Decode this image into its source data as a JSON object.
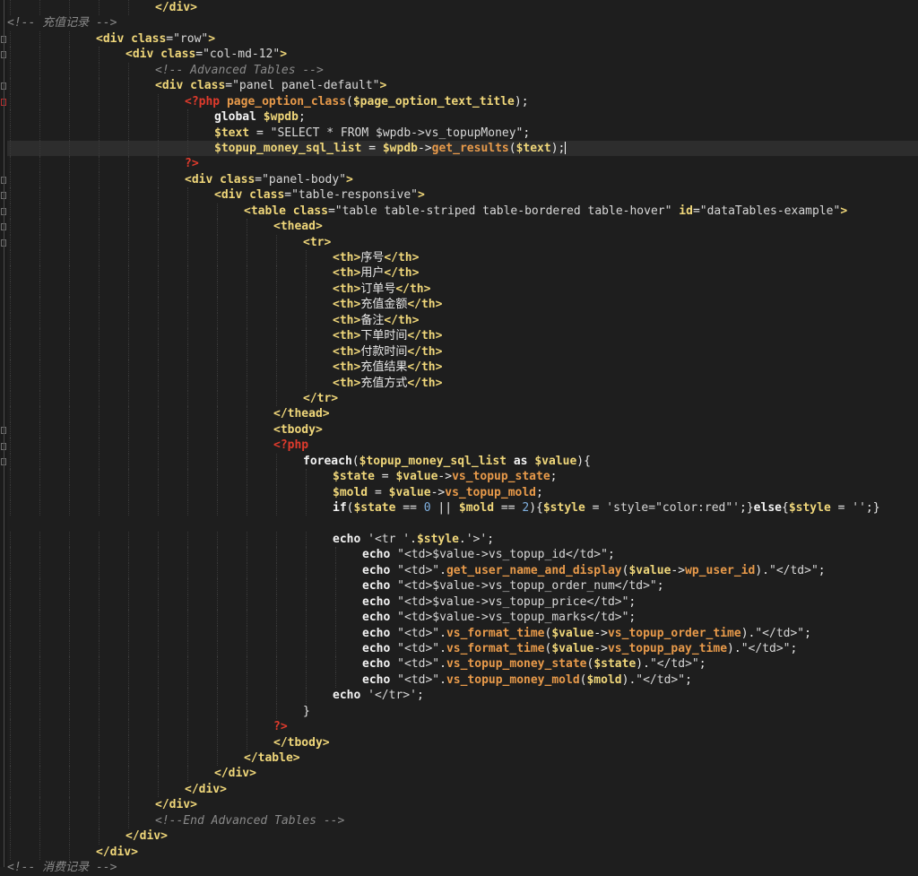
{
  "editor": {
    "title": "code-editor",
    "lines": [
      {
        "indent": 5,
        "tokens": [
          [
            "tag",
            "</div>"
          ]
        ]
      },
      {
        "indent": 0,
        "tokens": [
          [
            "comment",
            "<!-- 充值记录 -->"
          ]
        ]
      },
      {
        "indent": 3,
        "tokens": [
          [
            "tag",
            "<div "
          ],
          [
            "attr",
            "class"
          ],
          [
            "plain",
            "="
          ],
          [
            "str",
            "\"row\""
          ],
          [
            "tag",
            ">"
          ]
        ]
      },
      {
        "indent": 4,
        "tokens": [
          [
            "tag",
            "<div "
          ],
          [
            "attr",
            "class"
          ],
          [
            "plain",
            "="
          ],
          [
            "str",
            "\"col-md-12\""
          ],
          [
            "tag",
            ">"
          ]
        ]
      },
      {
        "indent": 5,
        "tokens": [
          [
            "comment",
            "<!-- Advanced Tables -->"
          ]
        ]
      },
      {
        "indent": 5,
        "tokens": [
          [
            "tag",
            "<div "
          ],
          [
            "attr",
            "class"
          ],
          [
            "plain",
            "="
          ],
          [
            "str",
            "\"panel panel-default\""
          ],
          [
            "tag",
            ">"
          ]
        ]
      },
      {
        "indent": 6,
        "tokens": [
          [
            "php",
            "<?php "
          ],
          [
            "fn",
            "page_option_class"
          ],
          [
            "punct",
            "("
          ],
          [
            "var",
            "$page_option_text_title"
          ],
          [
            "punct",
            ");"
          ]
        ]
      },
      {
        "indent": 7,
        "tokens": [
          [
            "kw",
            "global "
          ],
          [
            "var",
            "$wpdb"
          ],
          [
            "punct",
            ";"
          ]
        ]
      },
      {
        "indent": 7,
        "tokens": [
          [
            "var",
            "$text"
          ],
          [
            "plain",
            " = "
          ],
          [
            "str",
            "\"SELECT * FROM $wpdb->vs_topupMoney\""
          ],
          [
            "punct",
            ";"
          ]
        ]
      },
      {
        "indent": 7,
        "current": true,
        "tokens": [
          [
            "var",
            "$topup_money_sql_list"
          ],
          [
            "plain",
            " = "
          ],
          [
            "var",
            "$wpdb"
          ],
          [
            "plain",
            "->"
          ],
          [
            "fn",
            "get_results"
          ],
          [
            "punct",
            "("
          ],
          [
            "var",
            "$text"
          ],
          [
            "punct",
            ");"
          ],
          [
            "cursor",
            ""
          ]
        ]
      },
      {
        "indent": 6,
        "tokens": [
          [
            "php",
            "?>"
          ]
        ]
      },
      {
        "indent": 6,
        "tokens": [
          [
            "tag",
            "<div "
          ],
          [
            "attr",
            "class"
          ],
          [
            "plain",
            "="
          ],
          [
            "str",
            "\"panel-body\""
          ],
          [
            "tag",
            ">"
          ]
        ]
      },
      {
        "indent": 7,
        "tokens": [
          [
            "tag",
            "<div "
          ],
          [
            "attr",
            "class"
          ],
          [
            "plain",
            "="
          ],
          [
            "str",
            "\"table-responsive\""
          ],
          [
            "tag",
            ">"
          ]
        ]
      },
      {
        "indent": 8,
        "tokens": [
          [
            "tag",
            "<table "
          ],
          [
            "attr",
            "class"
          ],
          [
            "plain",
            "="
          ],
          [
            "str",
            "\"table table-striped table-bordered table-hover\""
          ],
          [
            "plain",
            " "
          ],
          [
            "attr",
            "id"
          ],
          [
            "plain",
            "="
          ],
          [
            "str",
            "\"dataTables-example\""
          ],
          [
            "tag",
            ">"
          ]
        ]
      },
      {
        "indent": 9,
        "tokens": [
          [
            "tag",
            "<thead>"
          ]
        ]
      },
      {
        "indent": 10,
        "tokens": [
          [
            "tag",
            "<tr>"
          ]
        ]
      },
      {
        "indent": 11,
        "tokens": [
          [
            "tag",
            "<th>"
          ],
          [
            "chinese",
            "序号"
          ],
          [
            "tag",
            "</th>"
          ]
        ]
      },
      {
        "indent": 11,
        "tokens": [
          [
            "tag",
            "<th>"
          ],
          [
            "chinese",
            "用户"
          ],
          [
            "tag",
            "</th>"
          ]
        ]
      },
      {
        "indent": 11,
        "tokens": [
          [
            "tag",
            "<th>"
          ],
          [
            "chinese",
            "订单号"
          ],
          [
            "tag",
            "</th>"
          ]
        ]
      },
      {
        "indent": 11,
        "tokens": [
          [
            "tag",
            "<th>"
          ],
          [
            "chinese",
            "充值金额"
          ],
          [
            "tag",
            "</th>"
          ]
        ]
      },
      {
        "indent": 11,
        "tokens": [
          [
            "tag",
            "<th>"
          ],
          [
            "chinese",
            "备注"
          ],
          [
            "tag",
            "</th>"
          ]
        ]
      },
      {
        "indent": 11,
        "tokens": [
          [
            "tag",
            "<th>"
          ],
          [
            "chinese",
            "下单时间"
          ],
          [
            "tag",
            "</th>"
          ]
        ]
      },
      {
        "indent": 11,
        "tokens": [
          [
            "tag",
            "<th>"
          ],
          [
            "chinese",
            "付款时间"
          ],
          [
            "tag",
            "</th>"
          ]
        ]
      },
      {
        "indent": 11,
        "tokens": [
          [
            "tag",
            "<th>"
          ],
          [
            "chinese",
            "充值结果"
          ],
          [
            "tag",
            "</th>"
          ]
        ]
      },
      {
        "indent": 11,
        "tokens": [
          [
            "tag",
            "<th>"
          ],
          [
            "chinese",
            "充值方式"
          ],
          [
            "tag",
            "</th>"
          ]
        ]
      },
      {
        "indent": 10,
        "tokens": [
          [
            "tag",
            "</tr>"
          ]
        ]
      },
      {
        "indent": 9,
        "tokens": [
          [
            "tag",
            "</thead>"
          ]
        ]
      },
      {
        "indent": 9,
        "tokens": [
          [
            "tag",
            "<tbody>"
          ]
        ]
      },
      {
        "indent": 9,
        "tokens": [
          [
            "php",
            "<?php"
          ]
        ]
      },
      {
        "indent": 10,
        "tokens": [
          [
            "kw",
            "foreach"
          ],
          [
            "punct",
            "("
          ],
          [
            "var",
            "$topup_money_sql_list"
          ],
          [
            "kw",
            " as "
          ],
          [
            "var",
            "$value"
          ],
          [
            "punct",
            "){"
          ]
        ]
      },
      {
        "indent": 11,
        "tokens": [
          [
            "var",
            "$state"
          ],
          [
            "plain",
            " = "
          ],
          [
            "var",
            "$value"
          ],
          [
            "plain",
            "->"
          ],
          [
            "fn",
            "vs_topup_state"
          ],
          [
            "punct",
            ";"
          ]
        ]
      },
      {
        "indent": 11,
        "tokens": [
          [
            "var",
            "$mold"
          ],
          [
            "plain",
            " = "
          ],
          [
            "var",
            "$value"
          ],
          [
            "plain",
            "->"
          ],
          [
            "fn",
            "vs_topup_mold"
          ],
          [
            "punct",
            ";"
          ]
        ]
      },
      {
        "indent": 11,
        "tokens": [
          [
            "kw",
            "if"
          ],
          [
            "punct",
            "("
          ],
          [
            "var",
            "$state"
          ],
          [
            "plain",
            " == "
          ],
          [
            "num",
            "0"
          ],
          [
            "plain",
            " || "
          ],
          [
            "var",
            "$mold"
          ],
          [
            "plain",
            " == "
          ],
          [
            "num",
            "2"
          ],
          [
            "punct",
            "){"
          ],
          [
            "var",
            "$style"
          ],
          [
            "plain",
            " = "
          ],
          [
            "str",
            "'style=\"color:red\"'"
          ],
          [
            "punct",
            ";}"
          ],
          [
            "kw",
            "else"
          ],
          [
            "punct",
            "{"
          ],
          [
            "var",
            "$style"
          ],
          [
            "plain",
            " = "
          ],
          [
            "str",
            "''"
          ],
          [
            "punct",
            ";}"
          ]
        ]
      },
      {
        "indent": 0,
        "tokens": []
      },
      {
        "indent": 11,
        "tokens": [
          [
            "kw",
            "echo "
          ],
          [
            "str",
            "'<tr '"
          ],
          [
            "plain",
            "."
          ],
          [
            "var",
            "$style"
          ],
          [
            "plain",
            "."
          ],
          [
            "str",
            "'>'"
          ],
          [
            "punct",
            ";"
          ]
        ]
      },
      {
        "indent": 12,
        "tokens": [
          [
            "kw",
            "echo "
          ],
          [
            "str",
            "\"<td>$value->vs_topup_id</td>\""
          ],
          [
            "punct",
            ";"
          ]
        ]
      },
      {
        "indent": 12,
        "tokens": [
          [
            "kw",
            "echo "
          ],
          [
            "str",
            "\"<td>\""
          ],
          [
            "plain",
            "."
          ],
          [
            "fn",
            "get_user_name_and_display"
          ],
          [
            "punct",
            "("
          ],
          [
            "var",
            "$value"
          ],
          [
            "plain",
            "->"
          ],
          [
            "fn",
            "wp_user_id"
          ],
          [
            "punct",
            ")"
          ],
          [
            "plain",
            "."
          ],
          [
            "str",
            "\"</td>\""
          ],
          [
            "punct",
            ";"
          ]
        ]
      },
      {
        "indent": 12,
        "tokens": [
          [
            "kw",
            "echo "
          ],
          [
            "str",
            "\"<td>$value->vs_topup_order_num</td>\""
          ],
          [
            "punct",
            ";"
          ]
        ]
      },
      {
        "indent": 12,
        "tokens": [
          [
            "kw",
            "echo "
          ],
          [
            "str",
            "\"<td>$value->vs_topup_price</td>\""
          ],
          [
            "punct",
            ";"
          ]
        ]
      },
      {
        "indent": 12,
        "tokens": [
          [
            "kw",
            "echo "
          ],
          [
            "str",
            "\"<td>$value->vs_topup_marks</td>\""
          ],
          [
            "punct",
            ";"
          ]
        ]
      },
      {
        "indent": 12,
        "tokens": [
          [
            "kw",
            "echo "
          ],
          [
            "str",
            "\"<td>\""
          ],
          [
            "plain",
            "."
          ],
          [
            "fn",
            "vs_format_time"
          ],
          [
            "punct",
            "("
          ],
          [
            "var",
            "$value"
          ],
          [
            "plain",
            "->"
          ],
          [
            "fn",
            "vs_topup_order_time"
          ],
          [
            "punct",
            ")"
          ],
          [
            "plain",
            "."
          ],
          [
            "str",
            "\"</td>\""
          ],
          [
            "punct",
            ";"
          ]
        ]
      },
      {
        "indent": 12,
        "tokens": [
          [
            "kw",
            "echo "
          ],
          [
            "str",
            "\"<td>\""
          ],
          [
            "plain",
            "."
          ],
          [
            "fn",
            "vs_format_time"
          ],
          [
            "punct",
            "("
          ],
          [
            "var",
            "$value"
          ],
          [
            "plain",
            "->"
          ],
          [
            "fn",
            "vs_topup_pay_time"
          ],
          [
            "punct",
            ")"
          ],
          [
            "plain",
            "."
          ],
          [
            "str",
            "\"</td>\""
          ],
          [
            "punct",
            ";"
          ]
        ]
      },
      {
        "indent": 12,
        "tokens": [
          [
            "kw",
            "echo "
          ],
          [
            "str",
            "\"<td>\""
          ],
          [
            "plain",
            "."
          ],
          [
            "fn",
            "vs_topup_money_state"
          ],
          [
            "punct",
            "("
          ],
          [
            "var",
            "$state"
          ],
          [
            "punct",
            ")"
          ],
          [
            "plain",
            "."
          ],
          [
            "str",
            "\"</td>\""
          ],
          [
            "punct",
            ";"
          ]
        ]
      },
      {
        "indent": 12,
        "tokens": [
          [
            "kw",
            "echo "
          ],
          [
            "str",
            "\"<td>\""
          ],
          [
            "plain",
            "."
          ],
          [
            "fn",
            "vs_topup_money_mold"
          ],
          [
            "punct",
            "("
          ],
          [
            "var",
            "$mold"
          ],
          [
            "punct",
            ")"
          ],
          [
            "plain",
            "."
          ],
          [
            "str",
            "\"</td>\""
          ],
          [
            "punct",
            ";"
          ]
        ]
      },
      {
        "indent": 11,
        "tokens": [
          [
            "kw",
            "echo "
          ],
          [
            "str",
            "'</tr>'"
          ],
          [
            "punct",
            ";"
          ]
        ]
      },
      {
        "indent": 10,
        "tokens": [
          [
            "punct",
            "}"
          ]
        ]
      },
      {
        "indent": 9,
        "tokens": [
          [
            "php",
            "?>"
          ]
        ]
      },
      {
        "indent": 9,
        "tokens": [
          [
            "tag",
            "</tbody>"
          ]
        ]
      },
      {
        "indent": 8,
        "tokens": [
          [
            "tag",
            "</table>"
          ]
        ]
      },
      {
        "indent": 7,
        "tokens": [
          [
            "tag",
            "</div>"
          ]
        ]
      },
      {
        "indent": 6,
        "tokens": [
          [
            "tag",
            "</div>"
          ]
        ]
      },
      {
        "indent": 5,
        "tokens": [
          [
            "tag",
            "</div>"
          ]
        ]
      },
      {
        "indent": 5,
        "tokens": [
          [
            "comment",
            "<!--End Advanced Tables -->"
          ]
        ]
      },
      {
        "indent": 4,
        "tokens": [
          [
            "tag",
            "</div>"
          ]
        ]
      },
      {
        "indent": 3,
        "tokens": [
          [
            "tag",
            "</div>"
          ]
        ]
      },
      {
        "indent": 0,
        "tokens": [
          [
            "comment",
            "<!-- 消费记录 -->"
          ]
        ]
      }
    ],
    "colors": {
      "background": "#1e1e1e",
      "current_line": "#2d2d2d",
      "tag": "#f0d77a",
      "php_delimiter": "#e03b2c",
      "function": "#e89a4a",
      "comment": "#8a8a8a",
      "number": "#7fb0e0"
    }
  }
}
